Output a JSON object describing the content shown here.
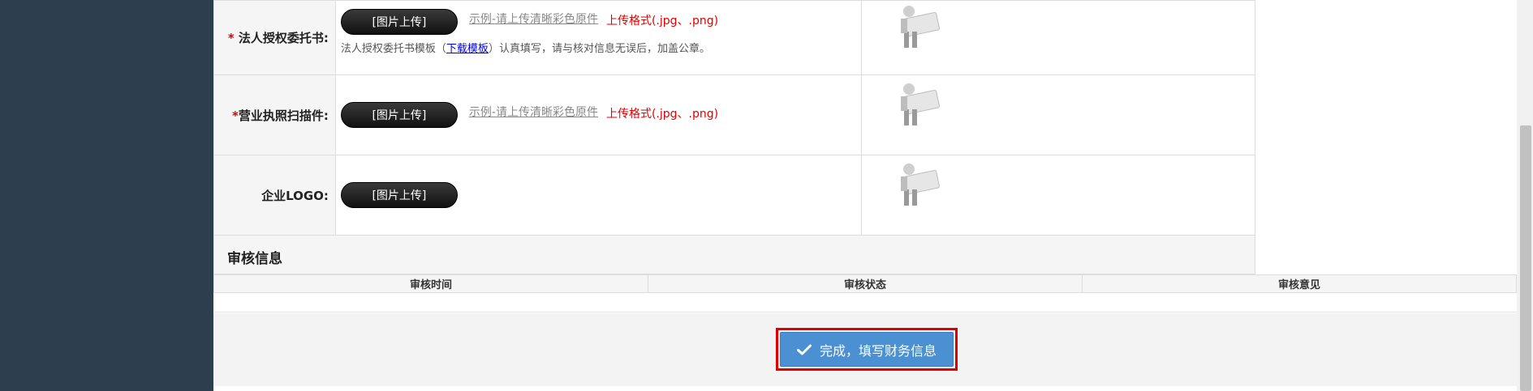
{
  "form": {
    "rows": [
      {
        "required_mark": "*",
        "label": "法人授权委托书:",
        "upload_label": "[图片上传]",
        "example_text": "示例-请上传清晰彩色原件",
        "format_text": "上传格式(.jpg、.png)",
        "hint_before": "法人授权委托书模板（",
        "hint_link": "下载模板",
        "hint_after": "）认真填写，请与核对信息无误后，加盖公章。"
      },
      {
        "required_mark": "*",
        "label": "营业执照扫描件:",
        "upload_label": "[图片上传]",
        "example_text": "示例-请上传清晰彩色原件",
        "format_text": "上传格式(.jpg、.png)"
      },
      {
        "label": "企业LOGO:",
        "upload_label": "[图片上传]"
      }
    ]
  },
  "audit": {
    "section_title": "审核信息",
    "columns": [
      "审核时间",
      "审核状态",
      "审核意见"
    ]
  },
  "footer": {
    "finish_label": "完成，填写财务信息"
  },
  "colors": {
    "sidebar": "#2d3e4e",
    "accent_button": "#4a90d2",
    "highlight_border": "#e00000",
    "required": "#e00000"
  }
}
